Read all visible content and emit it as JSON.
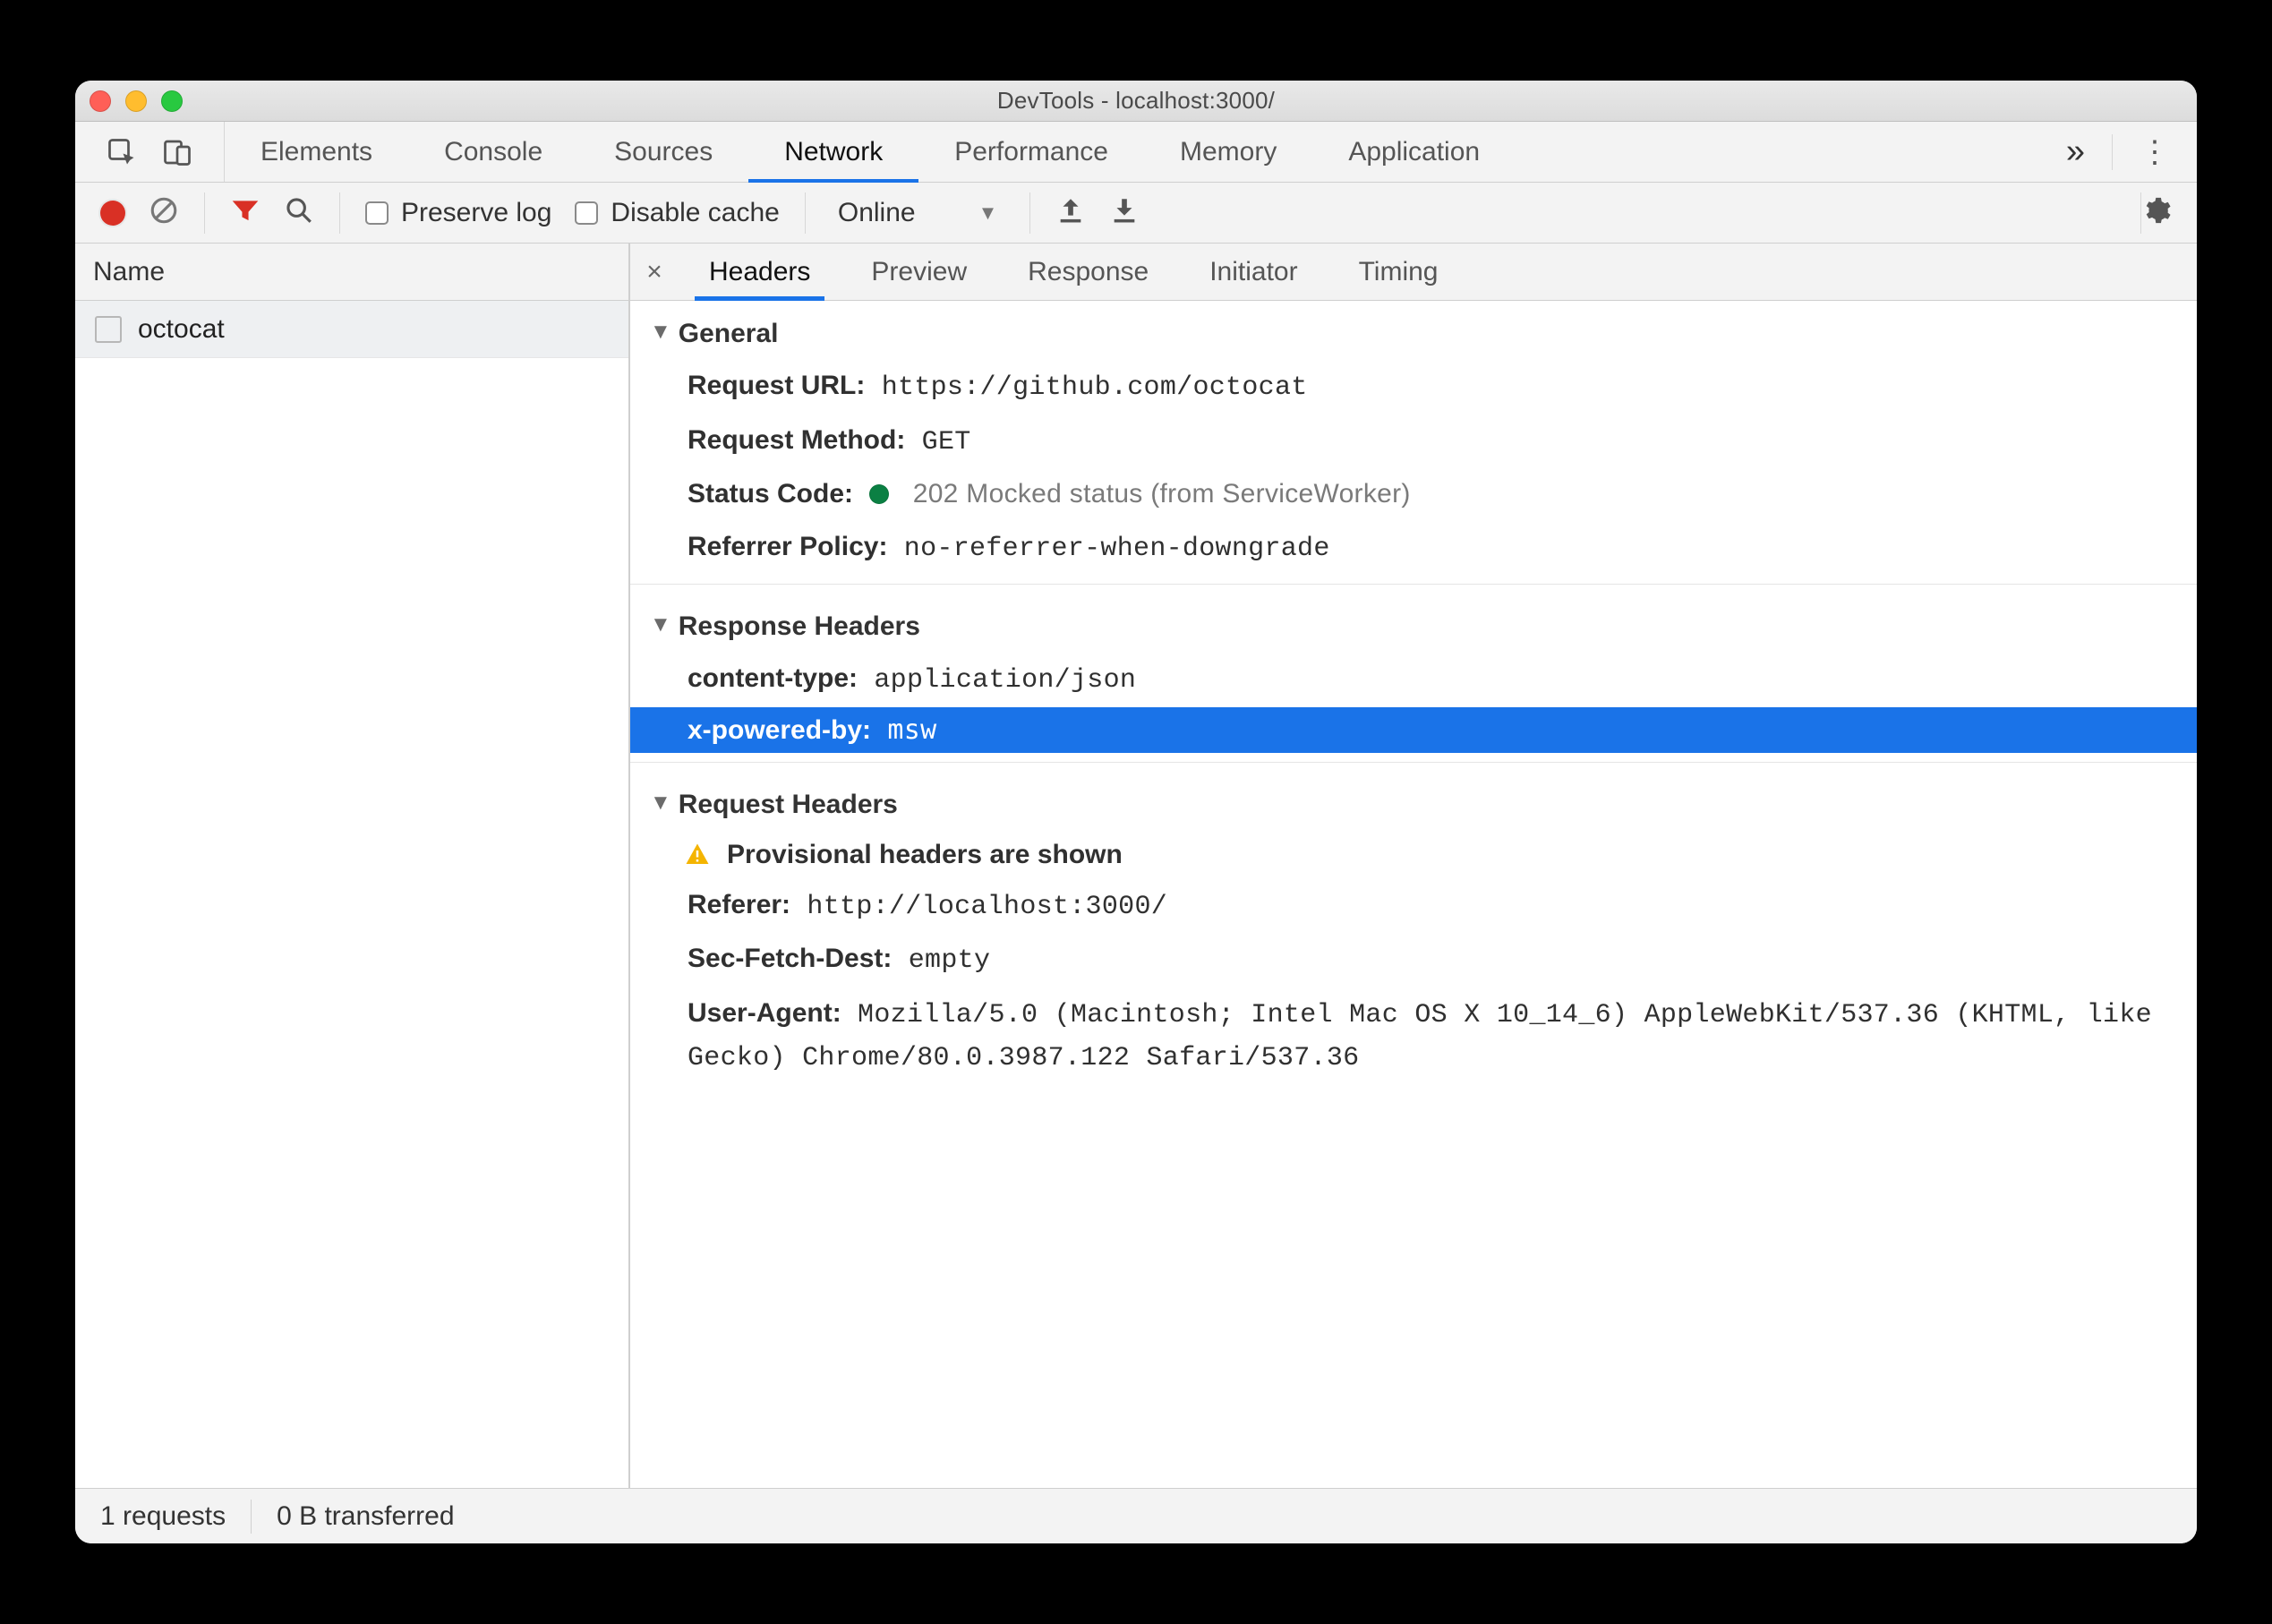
{
  "window": {
    "title": "DevTools - localhost:3000/"
  },
  "tabs": {
    "items": [
      "Elements",
      "Console",
      "Sources",
      "Network",
      "Performance",
      "Memory",
      "Application"
    ],
    "active_index": 3
  },
  "toolbar": {
    "preserve_log_label": "Preserve log",
    "disable_cache_label": "Disable cache",
    "throttling_value": "Online"
  },
  "requests": {
    "column_name": "Name",
    "items": [
      {
        "name": "octocat"
      }
    ]
  },
  "detail_tabs": {
    "items": [
      "Headers",
      "Preview",
      "Response",
      "Initiator",
      "Timing"
    ],
    "active_index": 0
  },
  "headers": {
    "general": {
      "title": "General",
      "request_url_label": "Request URL:",
      "request_url_value": "https://github.com/octocat",
      "request_method_label": "Request Method:",
      "request_method_value": "GET",
      "status_code_label": "Status Code:",
      "status_code_value": "202 Mocked status (from ServiceWorker)",
      "referrer_policy_label": "Referrer Policy:",
      "referrer_policy_value": "no-referrer-when-downgrade"
    },
    "response": {
      "title": "Response Headers",
      "content_type_label": "content-type:",
      "content_type_value": "application/json",
      "x_powered_by_label": "x-powered-by:",
      "x_powered_by_value": "msw"
    },
    "request": {
      "title": "Request Headers",
      "provisional_warning": "Provisional headers are shown",
      "referer_label": "Referer:",
      "referer_value": "http://localhost:3000/",
      "sec_fetch_dest_label": "Sec-Fetch-Dest:",
      "sec_fetch_dest_value": "empty",
      "user_agent_label": "User-Agent:",
      "user_agent_value": "Mozilla/5.0 (Macintosh; Intel Mac OS X 10_14_6) AppleWebKit/537.36 (KHTML, like Gecko) Chrome/80.0.3987.122 Safari/537.36"
    }
  },
  "statusbar": {
    "requests": "1 requests",
    "transferred": "0 B transferred"
  }
}
